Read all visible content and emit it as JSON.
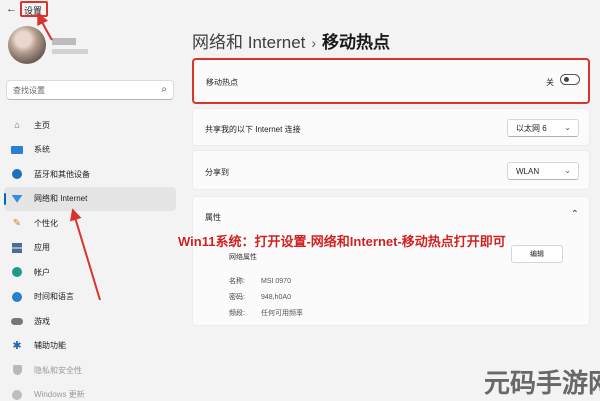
{
  "window": {
    "back_glyph": "←",
    "title": "设置"
  },
  "sidebar": {
    "search_placeholder": "查找设置",
    "items": [
      {
        "label": "主页",
        "icon": "home-icon"
      },
      {
        "label": "系统",
        "icon": "system-icon"
      },
      {
        "label": "蓝牙和其他设备",
        "icon": "bluetooth-icon"
      },
      {
        "label": "网络和 Internet",
        "icon": "network-icon",
        "active": true
      },
      {
        "label": "个性化",
        "icon": "brush-icon"
      },
      {
        "label": "应用",
        "icon": "apps-icon"
      },
      {
        "label": "帐户",
        "icon": "account-icon"
      },
      {
        "label": "时间和语言",
        "icon": "globe-icon"
      },
      {
        "label": "游戏",
        "icon": "gamepad-icon"
      },
      {
        "label": "辅助功能",
        "icon": "accessibility-icon"
      },
      {
        "label": "隐私和安全性",
        "icon": "shield-icon"
      },
      {
        "label": "Windows 更新",
        "icon": "windows-update-icon"
      }
    ]
  },
  "breadcrumb": {
    "parent": "网络和 Internet",
    "separator": "›",
    "current": "移动热点"
  },
  "hotspot": {
    "label": "移动热点",
    "toggle_state": "关"
  },
  "share": {
    "label": "共享我的以下 Internet 连接",
    "value": "以太网 6"
  },
  "share_to": {
    "label": "分享到",
    "value": "WLAN"
  },
  "properties": {
    "title": "属性",
    "subtitle": "网络属性",
    "edit_label": "编辑",
    "rows": [
      {
        "key": "名称:",
        "value": "MSI 0970"
      },
      {
        "key": "密码:",
        "value": "948,h0A0"
      },
      {
        "key": "频段:",
        "value": "任何可用频率"
      }
    ]
  },
  "annotation": {
    "caption": "Win11系统：打开设置-网络和Internet-移动热点打开即可",
    "color": "#d21f1f"
  },
  "watermark": "元码手游网",
  "colors": {
    "accent": "#0067c0",
    "highlight": "#d9342b"
  }
}
